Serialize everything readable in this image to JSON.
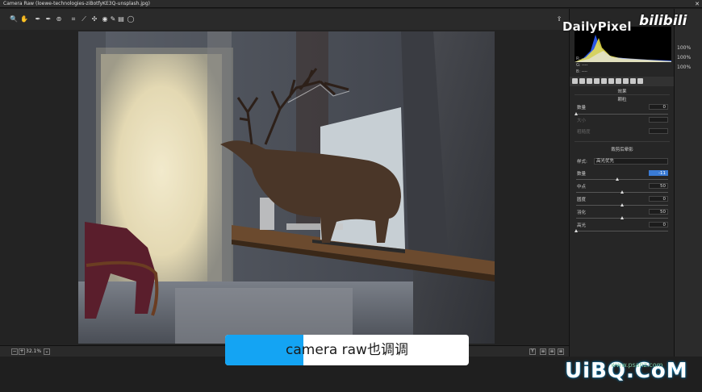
{
  "window": {
    "title": "Camera Raw (loewe-technologies-ziBotfyKE3Q-unsplash.jpg)",
    "close": "✕"
  },
  "toolbar": {
    "tools": [
      {
        "name": "zoom-tool-icon",
        "glyph": "🔍"
      },
      {
        "name": "hand-tool-icon",
        "glyph": "✋"
      },
      {
        "name": "white-balance-tool-icon",
        "glyph": "✒"
      },
      {
        "name": "color-sampler-tool-icon",
        "glyph": "✒"
      },
      {
        "name": "targeted-adjustment-tool-icon",
        "glyph": "⊚"
      },
      {
        "name": "crop-tool-icon",
        "glyph": "⌗"
      },
      {
        "name": "straighten-tool-icon",
        "glyph": "⟋"
      },
      {
        "name": "spot-removal-tool-icon",
        "glyph": "✣"
      },
      {
        "name": "red-eye-tool-icon",
        "glyph": "◉"
      },
      {
        "name": "adjustment-brush-icon",
        "glyph": "✎"
      },
      {
        "name": "graduated-filter-icon",
        "glyph": "▤"
      },
      {
        "name": "radial-filter-icon",
        "glyph": "◯"
      }
    ],
    "export_glyph": "⇪"
  },
  "bottom": {
    "zoom": "32.1%",
    "zoom_arrow": "⌄",
    "minus": "−",
    "plus": "+",
    "view_y": "Y",
    "view_btns": [
      "≡",
      "≡",
      "≡"
    ]
  },
  "histogram": {
    "r_label": "R:",
    "g_label": "G:",
    "b_label": "B:",
    "r_val": "----",
    "g_val": "----",
    "b_val": "----"
  },
  "panel": {
    "grain": {
      "title": "颗粒",
      "amount_label": "数量",
      "amount_value": "0",
      "amount_pos": 0,
      "size_label": "大小",
      "roughness_label": "粗糙度"
    },
    "vignette": {
      "title": "裁剪后晕影",
      "style_label": "样式:",
      "style_value": "高光优先",
      "rows": [
        {
          "label": "数量",
          "value": "-11",
          "pos": 0.45,
          "active": true
        },
        {
          "label": "中点",
          "value": "50",
          "pos": 0.5,
          "active": false
        },
        {
          "label": "圆度",
          "value": "0",
          "pos": 0.5,
          "active": false
        },
        {
          "label": "羽化",
          "value": "50",
          "pos": 0.5,
          "active": false
        },
        {
          "label": "高光",
          "value": "0",
          "pos": 0,
          "active": false
        }
      ]
    },
    "effects_label": "效果"
  },
  "far_right": {
    "pct_a": "100%",
    "pct_b": "100%",
    "pct_c": "100%"
  },
  "watermarks": {
    "dailypixel": "DailyPixel",
    "bilibili": "bilibili",
    "uibq": "UiBQ.CoM",
    "uibq_sub": "www.psahz.com"
  },
  "caption": {
    "text": "camera raw也调调"
  }
}
